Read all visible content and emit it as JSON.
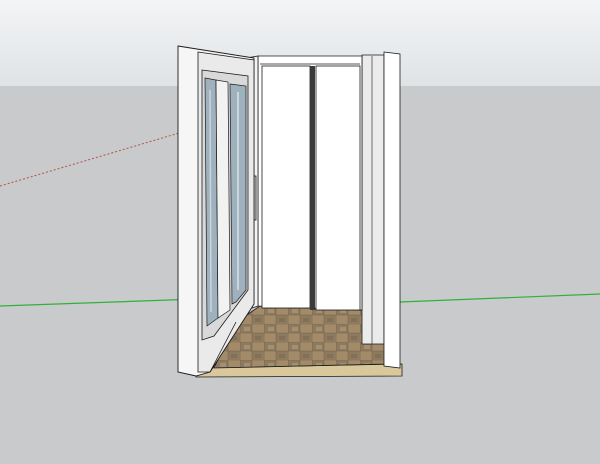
{
  "viewport": {
    "colors": {
      "sky_top": "#f3f4f5",
      "sky_bottom": "#dfe3e6",
      "ground": "#c9cacb",
      "red_axis": "#b0524f",
      "green_axis": "#2fb13a",
      "wall_face": "#ffffff",
      "wall_side": "#ebebeb",
      "edge": "#1b1b1b",
      "glass": "#9fb1bd",
      "floor_tile_light": "#a98f6e",
      "floor_tile_dark": "#6f5f4c",
      "floor_slab": "#d8c89c"
    },
    "model": {
      "name": "elevator-cabin-model",
      "open_door": "hinged-glass-door",
      "back_door": "sliding-double-door",
      "floor": "tiled-floor"
    }
  }
}
